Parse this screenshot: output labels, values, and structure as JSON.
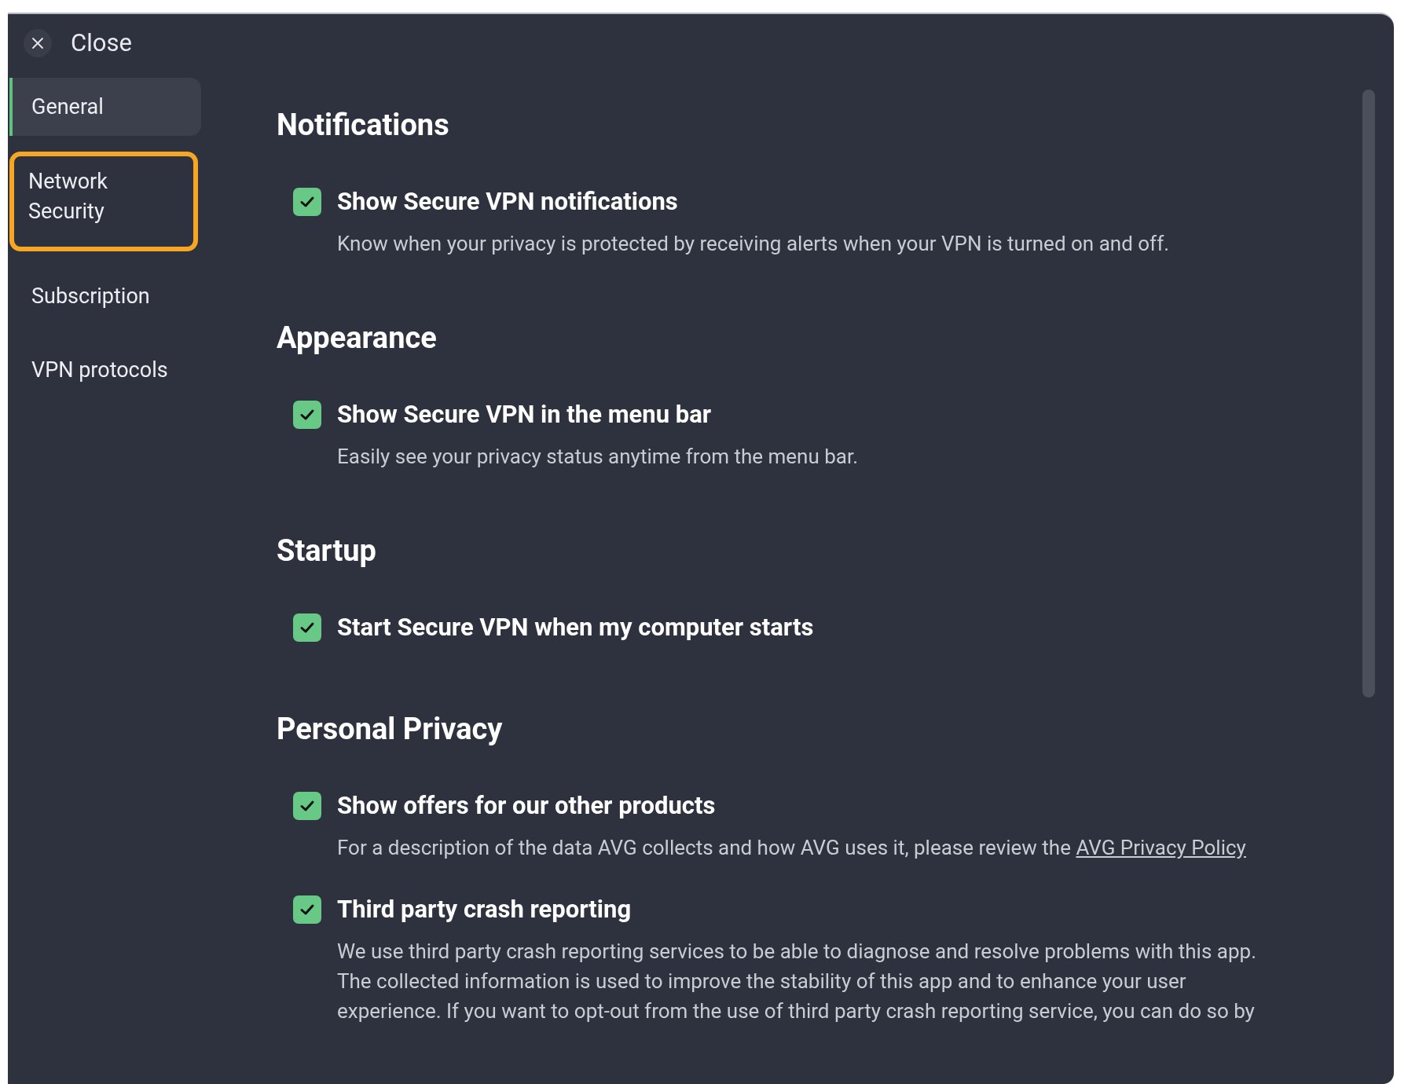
{
  "close_button": {
    "label": "Close"
  },
  "sidebar": {
    "items": [
      {
        "label": "General",
        "selected": true,
        "highlighted": false
      },
      {
        "label": "Network Security",
        "selected": false,
        "highlighted": true
      },
      {
        "label": "Subscription",
        "selected": false,
        "highlighted": false
      },
      {
        "label": "VPN protocols",
        "selected": false,
        "highlighted": false
      }
    ]
  },
  "sections": [
    {
      "heading": "Notifications",
      "options": [
        {
          "label": "Show Secure VPN notifications",
          "checked": true,
          "description": [
            "Know when your privacy is protected by receiving alerts when your VPN is turned on and off."
          ]
        }
      ]
    },
    {
      "heading": "Appearance",
      "options": [
        {
          "label": "Show Secure VPN in the menu bar",
          "checked": true,
          "description": [
            "Easily see your privacy status anytime from the menu bar."
          ]
        }
      ]
    },
    {
      "heading": "Startup",
      "options": [
        {
          "label": "Start Secure VPN when my computer starts",
          "checked": true
        }
      ]
    },
    {
      "heading": "Personal Privacy",
      "options": [
        {
          "label": "Show offers for our other products",
          "checked": true,
          "description": [
            "For a description of the data AVG collects and how AVG uses it, please review the"
          ],
          "link": "AVG Privacy Policy"
        },
        {
          "label": "Third party crash reporting",
          "checked": true,
          "description": [
            "We use third party crash reporting services to be able to diagnose and resolve problems with this app.",
            "The collected information is used to improve the stability of this app and to enhance your user",
            "experience. If you want to opt-out from the use of third party crash reporting service, you can do so by"
          ]
        }
      ]
    }
  ]
}
